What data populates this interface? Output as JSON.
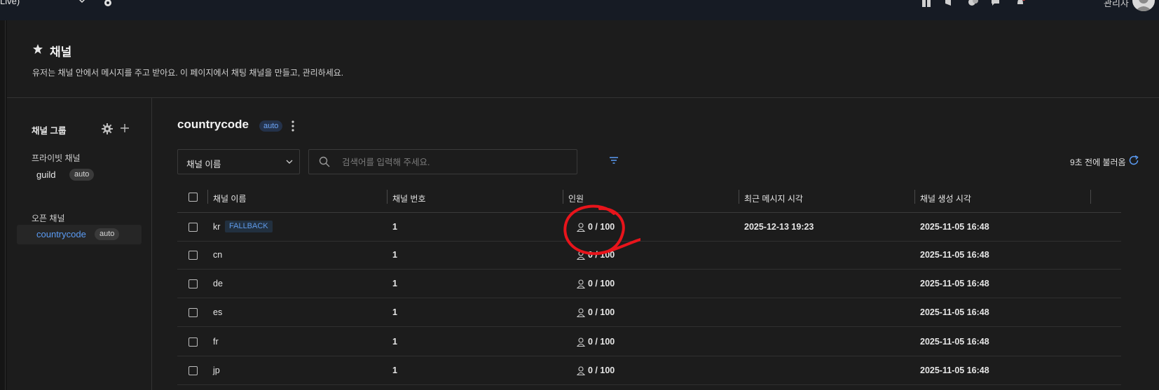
{
  "topbar": {
    "environment_label": "Live)",
    "user_label": "관리자",
    "icons": [
      "gift-icon",
      "megaphone-icon",
      "coins-icon",
      "chat-icon",
      "bell-icon"
    ]
  },
  "header": {
    "title": "채널",
    "description": "유저는 채널 안에서 메시지를 주고 받아요. 이 페이지에서 채팅 채널을 만들고, 관리하세요."
  },
  "sidebar": {
    "group_title": "채널 그룹",
    "private_section": "프라이빗 채널",
    "private_items": [
      {
        "label": "guild",
        "badge": "auto"
      }
    ],
    "open_section": "오픈 채널",
    "open_items": [
      {
        "label": "countrycode",
        "badge": "auto",
        "active": true
      }
    ]
  },
  "main": {
    "channel_title": "countrycode",
    "channel_badge": "auto",
    "filter_select": "채널 이름",
    "search_placeholder": "검색어를 입력해 주세요.",
    "reload_text": "9초 전에 불러옴"
  },
  "table": {
    "columns": [
      "채널 이름",
      "채널 번호",
      "인원",
      "최근 메시지 시각",
      "채널 생성 시각"
    ],
    "rows": [
      {
        "name": "kr",
        "badge": "FALLBACK",
        "number": "1",
        "members": "0 / 100",
        "last_message": "2025-12-13 19:23",
        "created": "2025-11-05 16:48"
      },
      {
        "name": "cn",
        "badge": "",
        "number": "1",
        "members": "0 / 100",
        "last_message": "",
        "created": "2025-11-05 16:48"
      },
      {
        "name": "de",
        "badge": "",
        "number": "1",
        "members": "0 / 100",
        "last_message": "",
        "created": "2025-11-05 16:48"
      },
      {
        "name": "es",
        "badge": "",
        "number": "1",
        "members": "0 / 100",
        "last_message": "",
        "created": "2025-11-05 16:48"
      },
      {
        "name": "fr",
        "badge": "",
        "number": "1",
        "members": "0 / 100",
        "last_message": "",
        "created": "2025-11-05 16:48"
      },
      {
        "name": "jp",
        "badge": "",
        "number": "1",
        "members": "0 / 100",
        "last_message": "",
        "created": "2025-11-05 16:48"
      }
    ]
  },
  "colors": {
    "background": "#1c1c1c",
    "topbar": "#161b24",
    "accent": "#5b9cf5",
    "annotation": "#e8141b"
  }
}
